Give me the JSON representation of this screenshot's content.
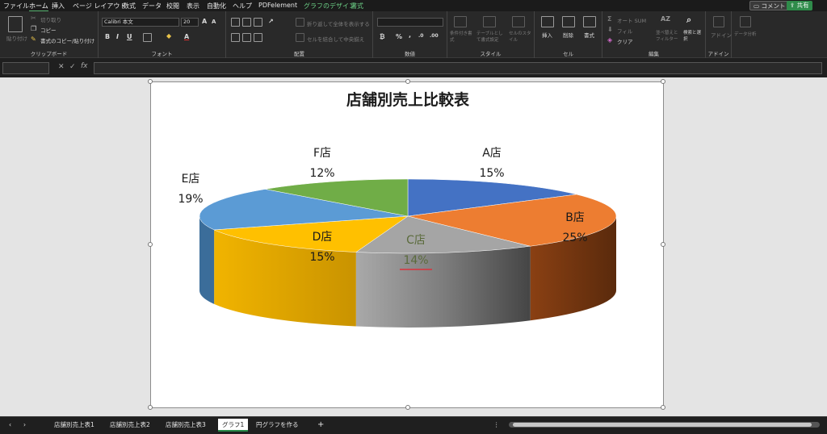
{
  "menu": {
    "items": [
      "ファイル",
      "ホーム",
      "挿入",
      "ページ レイアウト",
      "数式",
      "データ",
      "校閲",
      "表示",
      "自動化",
      "ヘルプ",
      "PDFelement",
      "グラフのデザイン",
      "書式"
    ],
    "active": "ホーム",
    "comment_label": "コメント",
    "share_label": "共有"
  },
  "ribbon": {
    "clipboard": {
      "paste": "貼り付け",
      "cut": "切り取り",
      "copy": "コピー",
      "format_painter": "書式のコピー/貼り付け",
      "label": "クリップボード"
    },
    "font": {
      "name": "Calibri 本文",
      "size": "20",
      "label": "フォント",
      "bold": "B",
      "italic": "I",
      "underline": "U",
      "grow": "A",
      "shrink": "A",
      "color_a": "A"
    },
    "alignment": {
      "wrap": "折り返して全体を表示する",
      "merge": "セルを結合して中央揃え",
      "label": "配置"
    },
    "number": {
      "format": "",
      "percent": "%",
      "comma": ",",
      "label": "数値"
    },
    "styles": {
      "conditional": "条件付き書式",
      "table": "テーブルとして書式設定",
      "cell": "セルのスタイル",
      "label": "スタイル"
    },
    "cells": {
      "insert": "挿入",
      "delete": "削除",
      "format": "書式",
      "label": "セル"
    },
    "editing": {
      "autosum": "オート SUM",
      "fill": "フィル",
      "clear": "クリア",
      "sort": "並べ替えとフィルター",
      "find": "検索と選択",
      "label": "編集"
    },
    "addins": {
      "addin": "アドイン",
      "label": "アドイン"
    },
    "analyze": {
      "label": "データ分析"
    }
  },
  "formula": {
    "name_box": "",
    "fx": "fx",
    "cancel": "✕",
    "enter": "✓",
    "value": ""
  },
  "chart_data": {
    "type": "pie",
    "title": "店舗別売上比較表",
    "categories": [
      "A店",
      "B店",
      "C店",
      "D店",
      "E店",
      "F店"
    ],
    "values": [
      15,
      25,
      14,
      15,
      19,
      12
    ],
    "labels_percent": [
      "15%",
      "25%",
      "14%",
      "15%",
      "19%",
      "12%"
    ],
    "colors": [
      "#4472c4",
      "#ed7d31",
      "#a5a5a5",
      "#ffc000",
      "#5b9bd5",
      "#70ad47"
    ],
    "style": "3d-pie",
    "legend": "none"
  },
  "sheets": {
    "tabs": [
      "店舗別売上表1",
      "店舗別売上表2",
      "店舗別売上表3",
      "グラフ1",
      "円グラフを作る"
    ],
    "active": "グラフ1",
    "add": "+",
    "prev": "‹",
    "next": "›"
  }
}
